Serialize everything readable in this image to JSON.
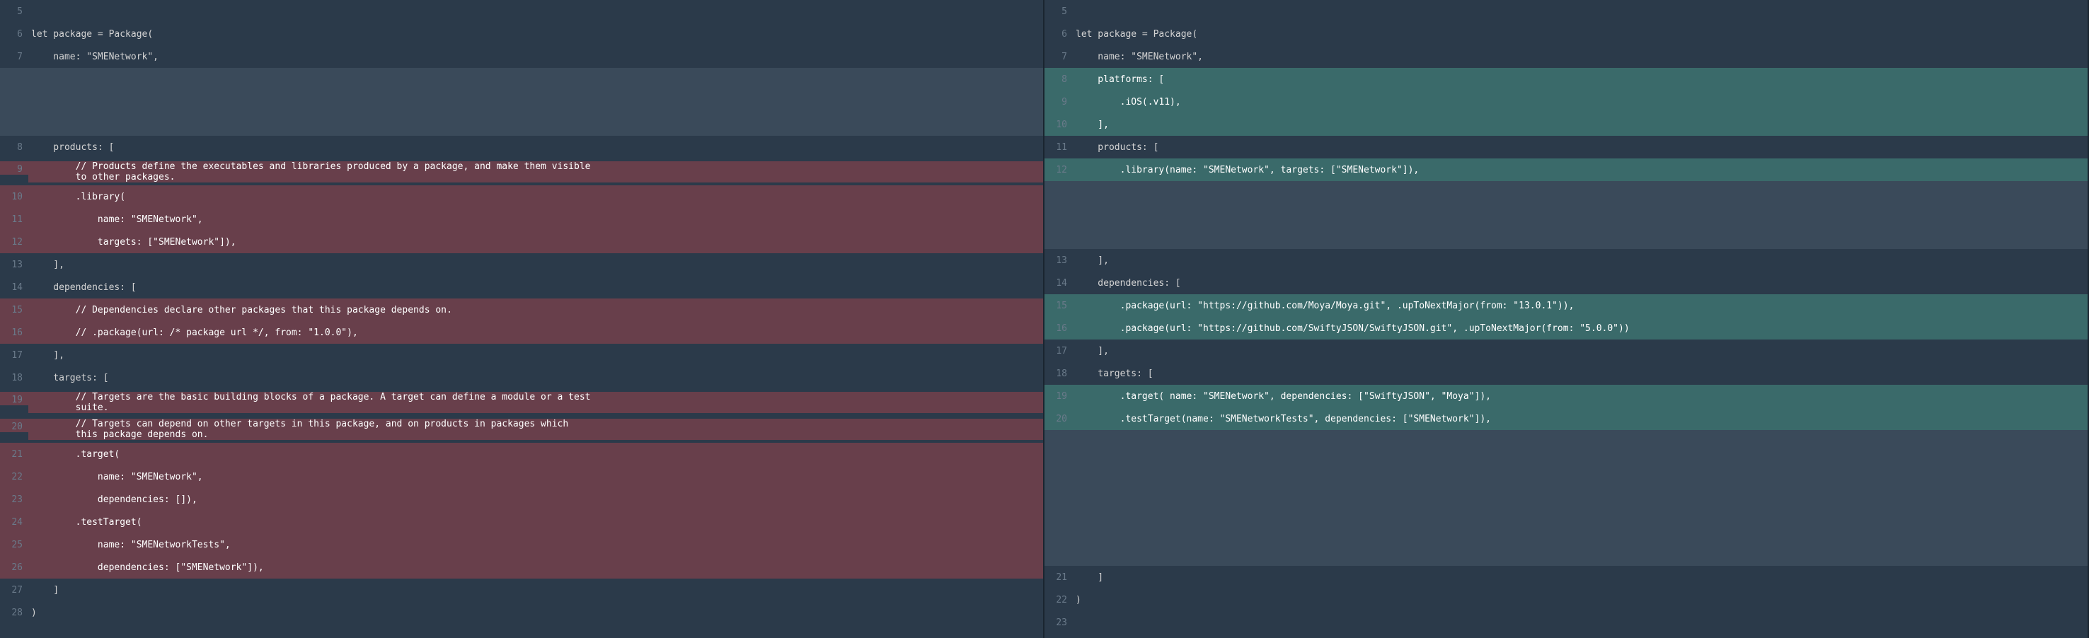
{
  "left": {
    "rows": [
      {
        "ln": "5",
        "type": "context",
        "text": ""
      },
      {
        "ln": "6",
        "type": "context",
        "text": "let package = Package("
      },
      {
        "ln": "7",
        "type": "context",
        "text": "    name: \"SMENetwork\","
      },
      {
        "ln": "",
        "type": "placeholder",
        "text": " "
      },
      {
        "ln": "",
        "type": "placeholder",
        "text": " "
      },
      {
        "ln": "",
        "type": "placeholder",
        "text": " "
      },
      {
        "ln": "8",
        "type": "context",
        "text": "    products: ["
      },
      {
        "ln": "9",
        "type": "removed",
        "text": "        // Products define the executables and libraries produced by a package, and make them visible\n        to other packages.",
        "multi": true
      },
      {
        "ln": "10",
        "type": "removed",
        "text": "        .library("
      },
      {
        "ln": "11",
        "type": "removed",
        "text": "            name: \"SMENetwork\","
      },
      {
        "ln": "12",
        "type": "removed",
        "text": "            targets: [\"SMENetwork\"]),"
      },
      {
        "ln": "13",
        "type": "context",
        "text": "    ],"
      },
      {
        "ln": "14",
        "type": "context",
        "text": "    dependencies: ["
      },
      {
        "ln": "15",
        "type": "removed",
        "text": "        // Dependencies declare other packages that this package depends on."
      },
      {
        "ln": "16",
        "type": "removed",
        "text": "        // .package(url: /* package url */, from: \"1.0.0\"),"
      },
      {
        "ln": "17",
        "type": "context",
        "text": "    ],"
      },
      {
        "ln": "18",
        "type": "context",
        "text": "    targets: ["
      },
      {
        "ln": "19",
        "type": "removed",
        "text": "        // Targets are the basic building blocks of a package. A target can define a module or a test\n        suite.",
        "multi": true
      },
      {
        "ln": "20",
        "type": "removed",
        "text": "        // Targets can depend on other targets in this package, and on products in packages which\n        this package depends on.",
        "multi": true
      },
      {
        "ln": "21",
        "type": "removed",
        "text": "        .target("
      },
      {
        "ln": "22",
        "type": "removed",
        "text": "            name: \"SMENetwork\","
      },
      {
        "ln": "23",
        "type": "removed",
        "text": "            dependencies: []),"
      },
      {
        "ln": "24",
        "type": "removed",
        "text": "        .testTarget("
      },
      {
        "ln": "25",
        "type": "removed",
        "text": "            name: \"SMENetworkTests\","
      },
      {
        "ln": "26",
        "type": "removed",
        "text": "            dependencies: [\"SMENetwork\"]),"
      },
      {
        "ln": "27",
        "type": "context",
        "text": "    ]"
      },
      {
        "ln": "28",
        "type": "context",
        "text": ")"
      }
    ]
  },
  "right": {
    "rows": [
      {
        "ln": "5",
        "type": "context",
        "text": ""
      },
      {
        "ln": "6",
        "type": "context",
        "text": "let package = Package("
      },
      {
        "ln": "7",
        "type": "context",
        "text": "    name: \"SMENetwork\","
      },
      {
        "ln": "8",
        "type": "added",
        "text": "    platforms: ["
      },
      {
        "ln": "9",
        "type": "added",
        "text": "        .iOS(.v11),"
      },
      {
        "ln": "10",
        "type": "added",
        "text": "    ],"
      },
      {
        "ln": "11",
        "type": "context",
        "text": "    products: ["
      },
      {
        "ln": "12",
        "type": "added",
        "text": "        .library(name: \"SMENetwork\", targets: [\"SMENetwork\"]),"
      },
      {
        "ln": "",
        "type": "placeholder",
        "text": " "
      },
      {
        "ln": "",
        "type": "placeholder",
        "text": " "
      },
      {
        "ln": "",
        "type": "placeholder",
        "text": " "
      },
      {
        "ln": "13",
        "type": "context",
        "text": "    ],"
      },
      {
        "ln": "14",
        "type": "context",
        "text": "    dependencies: ["
      },
      {
        "ln": "15",
        "type": "added",
        "text": "        .package(url: \"https://github.com/Moya/Moya.git\", .upToNextMajor(from: \"13.0.1\")),"
      },
      {
        "ln": "16",
        "type": "added",
        "text": "        .package(url: \"https://github.com/SwiftyJSON/SwiftyJSON.git\", .upToNextMajor(from: \"5.0.0\"))"
      },
      {
        "ln": "17",
        "type": "context",
        "text": "    ],"
      },
      {
        "ln": "18",
        "type": "context",
        "text": "    targets: ["
      },
      {
        "ln": "19",
        "type": "added",
        "text": "        .target( name: \"SMENetwork\", dependencies: [\"SwiftyJSON\", \"Moya\"]),"
      },
      {
        "ln": "20",
        "type": "added",
        "text": "        .testTarget(name: \"SMENetworkTests\", dependencies: [\"SMENetwork\"]),"
      },
      {
        "ln": "",
        "type": "placeholder",
        "text": " "
      },
      {
        "ln": "",
        "type": "placeholder",
        "text": " "
      },
      {
        "ln": "",
        "type": "placeholder",
        "text": " "
      },
      {
        "ln": "",
        "type": "placeholder",
        "text": " "
      },
      {
        "ln": "",
        "type": "placeholder",
        "text": " "
      },
      {
        "ln": "",
        "type": "placeholder",
        "text": " "
      },
      {
        "ln": "21",
        "type": "context",
        "text": "    ]"
      },
      {
        "ln": "22",
        "type": "context",
        "text": ")"
      },
      {
        "ln": "23",
        "type": "context",
        "text": ""
      }
    ]
  }
}
